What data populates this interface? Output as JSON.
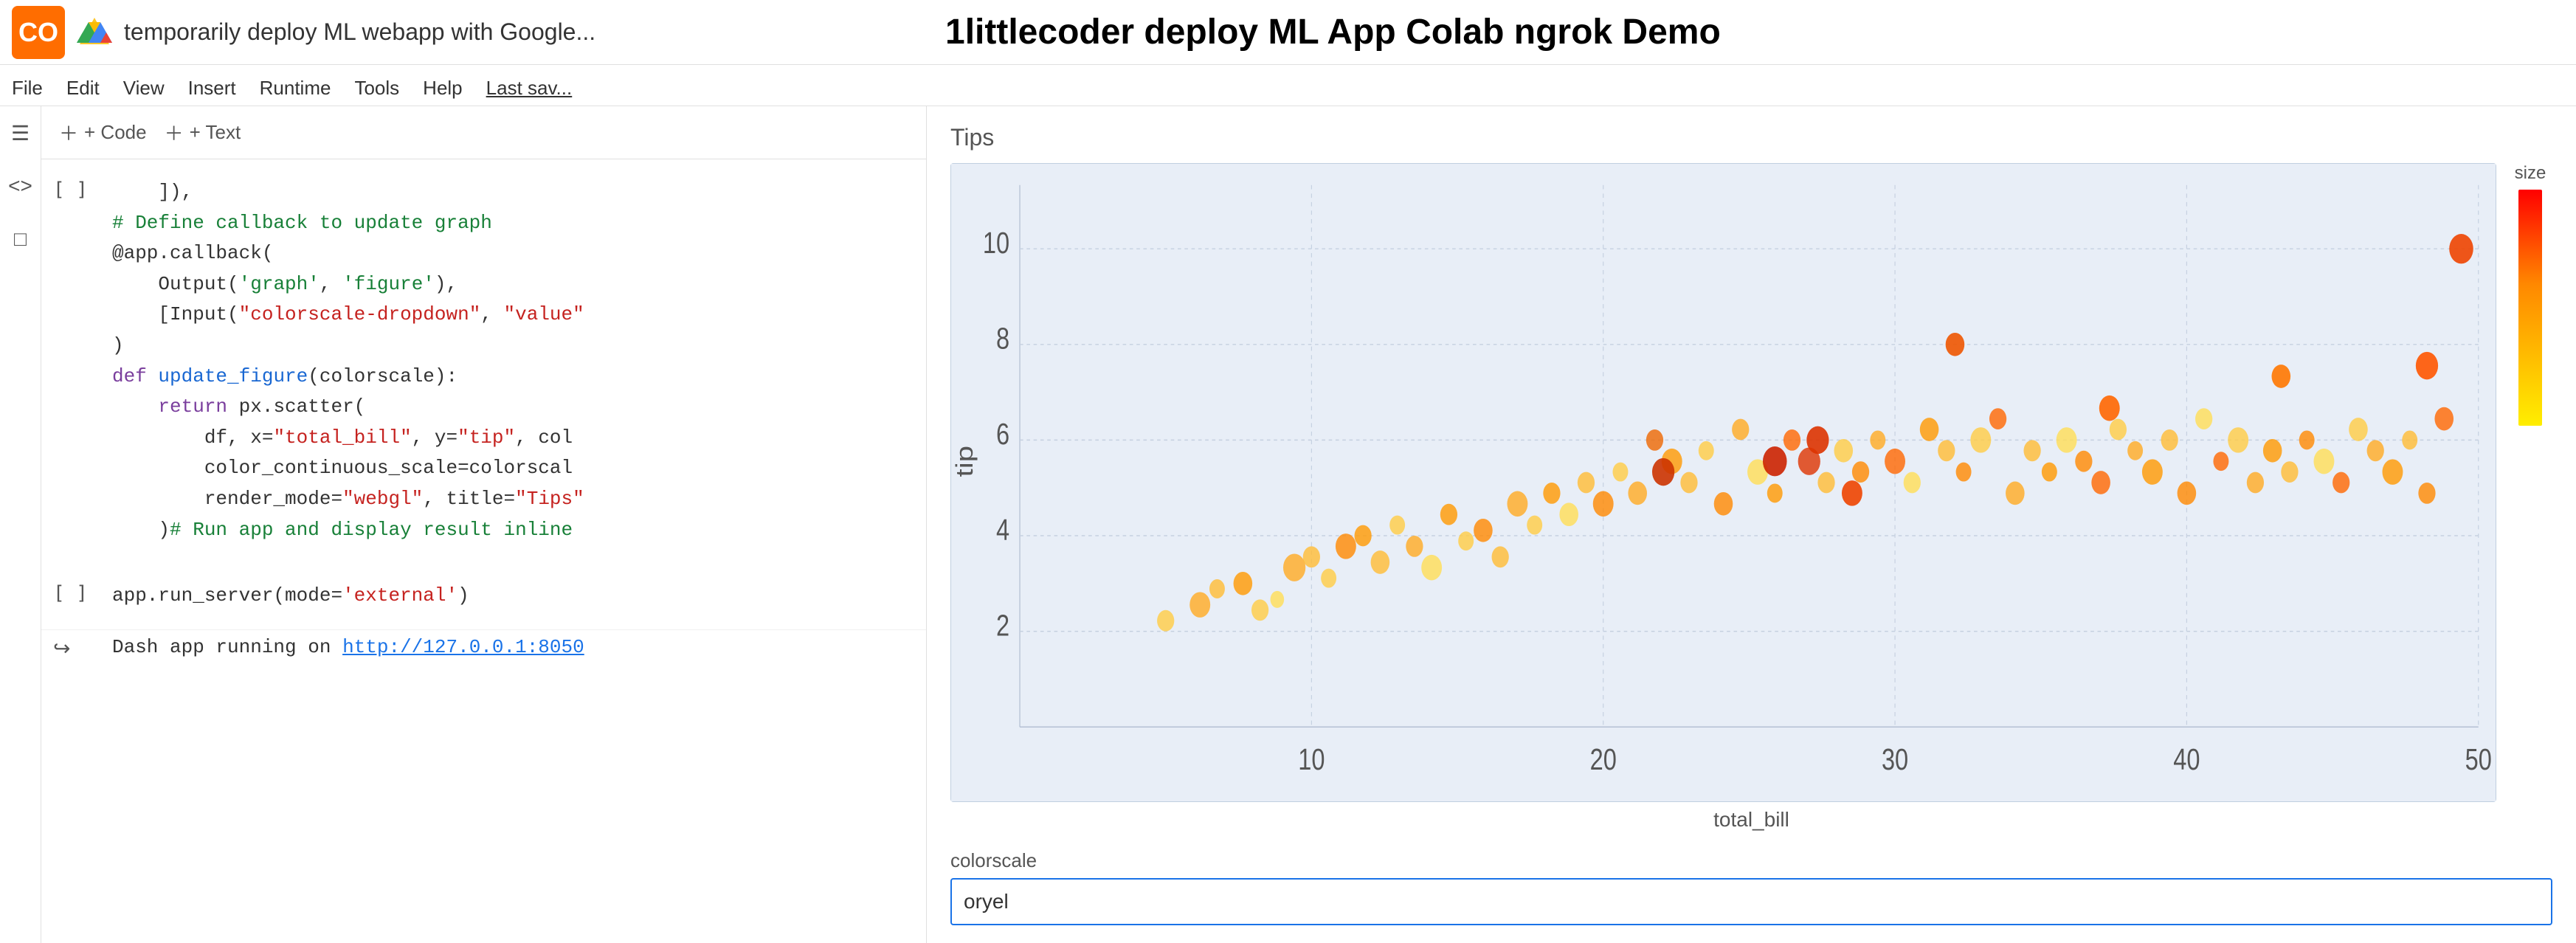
{
  "header": {
    "logo_text": "CO",
    "title_left": "temporarily deploy ML webapp with Google...",
    "title_right": "1littlecoder deploy ML App Colab ngrok Demo"
  },
  "menu": {
    "items": [
      "File",
      "Edit",
      "View",
      "Insert",
      "Runtime",
      "Tools",
      "Help",
      "Last sav..."
    ]
  },
  "toolbar": {
    "code_label": "+ Code",
    "text_label": "+ Text"
  },
  "code_cell": {
    "bracket": "[ ]",
    "lines": [
      "    ]),",
      "# Define callback to update graph",
      "@app.callback(",
      "    Output('graph', 'figure'),",
      "    [Input(\"colorscale-dropdown\", \"value\"",
      ")",
      "def update_figure(colorscale):",
      "    return px.scatter(",
      "        df, x=\"total_bill\", y=\"tip\", col",
      "        color_continuous_scale=colorscal",
      "        render_mode=\"webgl\", title=\"Tips\"",
      "    )# Run app and display result inline"
    ]
  },
  "run_cell": {
    "bracket": "[ ]",
    "code": "app.run_server(mode='external')"
  },
  "output_cell": {
    "icon": "↪",
    "text": "Dash app running on ",
    "link": "http://127.0.0.1:8050"
  },
  "chart": {
    "title": "Tips",
    "x_axis_label": "total_bill",
    "y_axis_label": "tip",
    "colorbar_label": "size",
    "x_ticks": [
      "10",
      "20",
      "30",
      "40",
      "50"
    ],
    "y_ticks": [
      "2",
      "4",
      "6",
      "8",
      "10"
    ]
  },
  "colorscale": {
    "label": "colorscale",
    "value": "oryel",
    "placeholder": "oryel"
  },
  "sidebar": {
    "icons": [
      "≡",
      "<>",
      "□"
    ]
  }
}
